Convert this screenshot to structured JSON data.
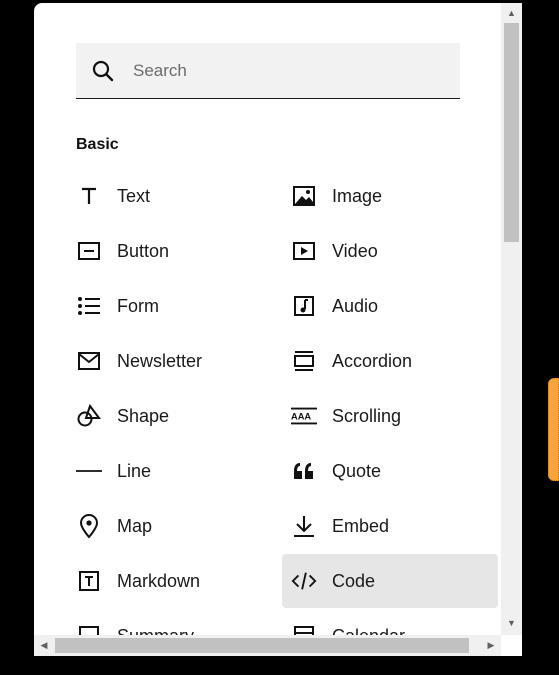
{
  "search": {
    "placeholder": "Search"
  },
  "section": {
    "title": "Basic"
  },
  "items": {
    "text": "Text",
    "image": "Image",
    "button": "Button",
    "video": "Video",
    "form": "Form",
    "audio": "Audio",
    "newsletter": "Newsletter",
    "accordion": "Accordion",
    "shape": "Shape",
    "scrolling": "Scrolling",
    "line": "Line",
    "quote": "Quote",
    "map": "Map",
    "embed": "Embed",
    "markdown": "Markdown",
    "code": "Code",
    "summary": "Summary",
    "calendar": "Calendar"
  },
  "selected_item": "Code",
  "colors": {
    "selected_bg": "#e6e6e6",
    "search_bg": "#f2f2f2",
    "side_handle": "#f7a43c"
  }
}
